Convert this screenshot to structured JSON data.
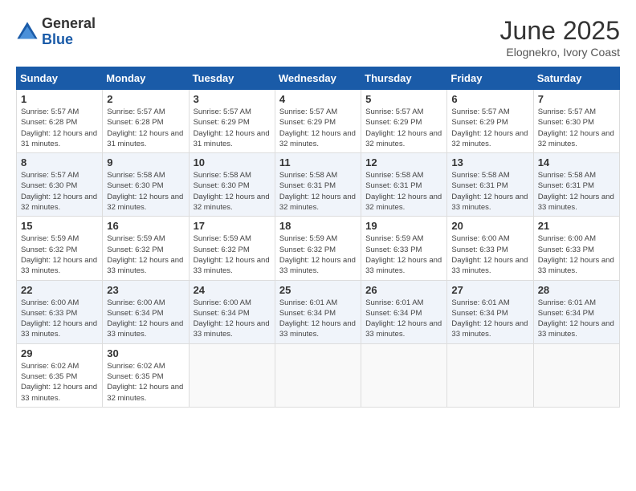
{
  "logo": {
    "general": "General",
    "blue": "Blue"
  },
  "title": "June 2025",
  "subtitle": "Elognekro, Ivory Coast",
  "days_of_week": [
    "Sunday",
    "Monday",
    "Tuesday",
    "Wednesday",
    "Thursday",
    "Friday",
    "Saturday"
  ],
  "weeks": [
    [
      {
        "day": "1",
        "sunrise": "5:57 AM",
        "sunset": "6:28 PM",
        "daylight": "12 hours and 31 minutes."
      },
      {
        "day": "2",
        "sunrise": "5:57 AM",
        "sunset": "6:28 PM",
        "daylight": "12 hours and 31 minutes."
      },
      {
        "day": "3",
        "sunrise": "5:57 AM",
        "sunset": "6:29 PM",
        "daylight": "12 hours and 31 minutes."
      },
      {
        "day": "4",
        "sunrise": "5:57 AM",
        "sunset": "6:29 PM",
        "daylight": "12 hours and 32 minutes."
      },
      {
        "day": "5",
        "sunrise": "5:57 AM",
        "sunset": "6:29 PM",
        "daylight": "12 hours and 32 minutes."
      },
      {
        "day": "6",
        "sunrise": "5:57 AM",
        "sunset": "6:29 PM",
        "daylight": "12 hours and 32 minutes."
      },
      {
        "day": "7",
        "sunrise": "5:57 AM",
        "sunset": "6:30 PM",
        "daylight": "12 hours and 32 minutes."
      }
    ],
    [
      {
        "day": "8",
        "sunrise": "5:57 AM",
        "sunset": "6:30 PM",
        "daylight": "12 hours and 32 minutes."
      },
      {
        "day": "9",
        "sunrise": "5:58 AM",
        "sunset": "6:30 PM",
        "daylight": "12 hours and 32 minutes."
      },
      {
        "day": "10",
        "sunrise": "5:58 AM",
        "sunset": "6:30 PM",
        "daylight": "12 hours and 32 minutes."
      },
      {
        "day": "11",
        "sunrise": "5:58 AM",
        "sunset": "6:31 PM",
        "daylight": "12 hours and 32 minutes."
      },
      {
        "day": "12",
        "sunrise": "5:58 AM",
        "sunset": "6:31 PM",
        "daylight": "12 hours and 32 minutes."
      },
      {
        "day": "13",
        "sunrise": "5:58 AM",
        "sunset": "6:31 PM",
        "daylight": "12 hours and 33 minutes."
      },
      {
        "day": "14",
        "sunrise": "5:58 AM",
        "sunset": "6:31 PM",
        "daylight": "12 hours and 33 minutes."
      }
    ],
    [
      {
        "day": "15",
        "sunrise": "5:59 AM",
        "sunset": "6:32 PM",
        "daylight": "12 hours and 33 minutes."
      },
      {
        "day": "16",
        "sunrise": "5:59 AM",
        "sunset": "6:32 PM",
        "daylight": "12 hours and 33 minutes."
      },
      {
        "day": "17",
        "sunrise": "5:59 AM",
        "sunset": "6:32 PM",
        "daylight": "12 hours and 33 minutes."
      },
      {
        "day": "18",
        "sunrise": "5:59 AM",
        "sunset": "6:32 PM",
        "daylight": "12 hours and 33 minutes."
      },
      {
        "day": "19",
        "sunrise": "5:59 AM",
        "sunset": "6:33 PM",
        "daylight": "12 hours and 33 minutes."
      },
      {
        "day": "20",
        "sunrise": "6:00 AM",
        "sunset": "6:33 PM",
        "daylight": "12 hours and 33 minutes."
      },
      {
        "day": "21",
        "sunrise": "6:00 AM",
        "sunset": "6:33 PM",
        "daylight": "12 hours and 33 minutes."
      }
    ],
    [
      {
        "day": "22",
        "sunrise": "6:00 AM",
        "sunset": "6:33 PM",
        "daylight": "12 hours and 33 minutes."
      },
      {
        "day": "23",
        "sunrise": "6:00 AM",
        "sunset": "6:34 PM",
        "daylight": "12 hours and 33 minutes."
      },
      {
        "day": "24",
        "sunrise": "6:00 AM",
        "sunset": "6:34 PM",
        "daylight": "12 hours and 33 minutes."
      },
      {
        "day": "25",
        "sunrise": "6:01 AM",
        "sunset": "6:34 PM",
        "daylight": "12 hours and 33 minutes."
      },
      {
        "day": "26",
        "sunrise": "6:01 AM",
        "sunset": "6:34 PM",
        "daylight": "12 hours and 33 minutes."
      },
      {
        "day": "27",
        "sunrise": "6:01 AM",
        "sunset": "6:34 PM",
        "daylight": "12 hours and 33 minutes."
      },
      {
        "day": "28",
        "sunrise": "6:01 AM",
        "sunset": "6:34 PM",
        "daylight": "12 hours and 33 minutes."
      }
    ],
    [
      {
        "day": "29",
        "sunrise": "6:02 AM",
        "sunset": "6:35 PM",
        "daylight": "12 hours and 33 minutes."
      },
      {
        "day": "30",
        "sunrise": "6:02 AM",
        "sunset": "6:35 PM",
        "daylight": "12 hours and 32 minutes."
      },
      null,
      null,
      null,
      null,
      null
    ]
  ]
}
